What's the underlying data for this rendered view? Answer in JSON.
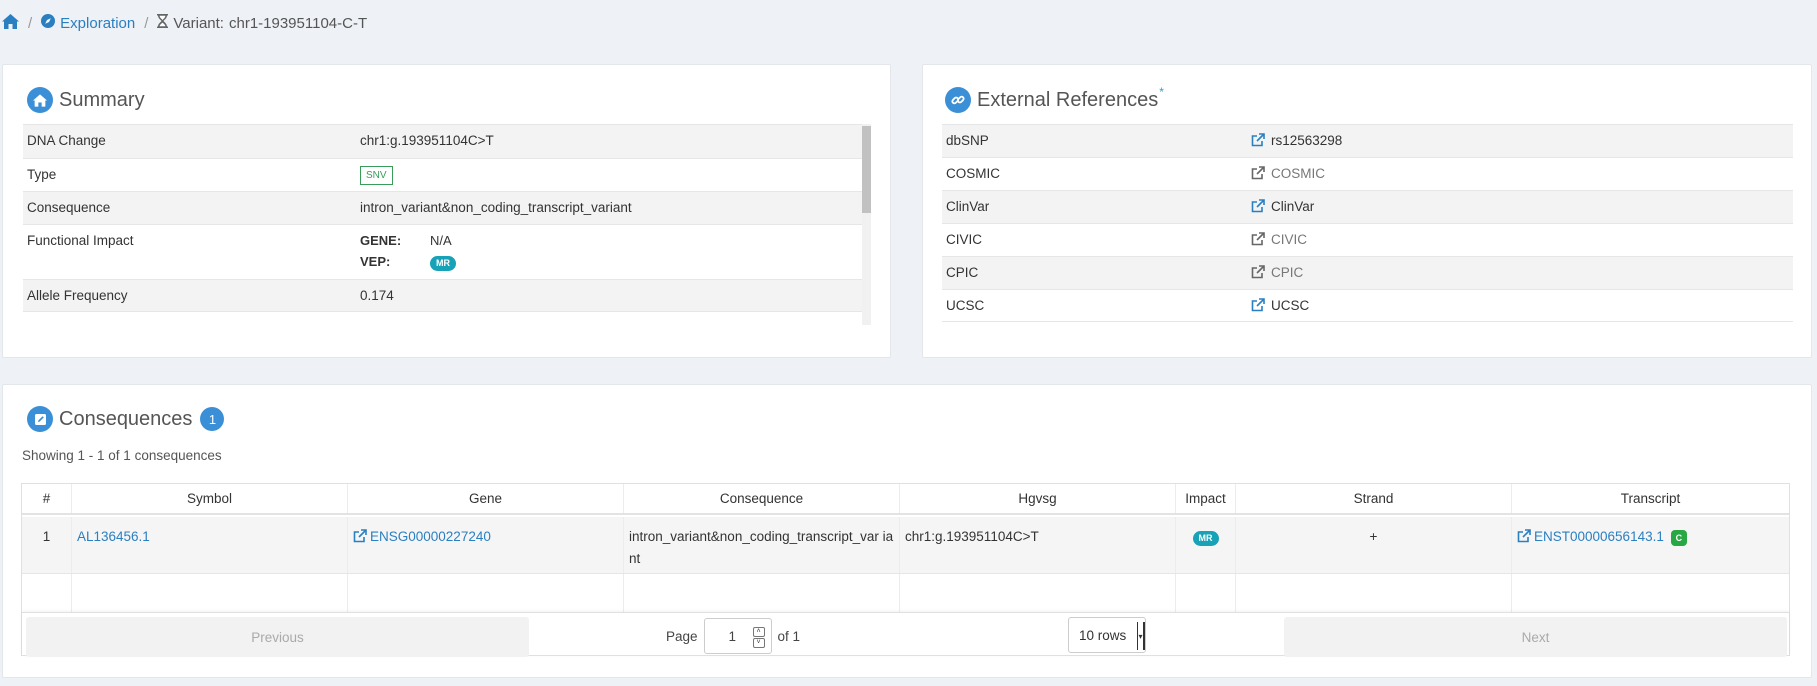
{
  "breadcrumb": {
    "exploration": "Exploration",
    "variant_prefix": "Variant:",
    "variant_id": "chr1-193951104-C-T"
  },
  "summary": {
    "title": "Summary",
    "rows": [
      {
        "key": "DNA Change",
        "value": "chr1:g.193951104C>T"
      },
      {
        "key": "Type",
        "value": "SNV"
      },
      {
        "key": "Consequence",
        "value": "intron_variant&non_coding_transcript_variant"
      },
      {
        "key": "Functional Impact",
        "gene_label": "GENE:",
        "gene_value": "N/A",
        "vep_label": "VEP:",
        "vep_value": "MR"
      },
      {
        "key": "Allele Frequency",
        "value": "0.174"
      }
    ]
  },
  "external": {
    "title": "External References",
    "asterisk": "*",
    "rows": [
      {
        "key": "dbSNP",
        "value": "rs12563298",
        "active": true
      },
      {
        "key": "COSMIC",
        "value": "COSMIC",
        "active": false
      },
      {
        "key": "ClinVar",
        "value": "ClinVar",
        "active": true
      },
      {
        "key": "CIVIC",
        "value": "CIVIC",
        "active": false
      },
      {
        "key": "CPIC",
        "value": "CPIC",
        "active": false
      },
      {
        "key": "UCSC",
        "value": "UCSC",
        "active": true
      }
    ]
  },
  "consequences": {
    "title": "Consequences",
    "count": "1",
    "showing": "Showing 1 - 1 of 1 consequences",
    "columns": [
      "#",
      "Symbol",
      "Gene",
      "Consequence",
      "Hgvsg",
      "Impact",
      "Strand",
      "Transcript"
    ],
    "rows": [
      {
        "num": "1",
        "symbol": "AL136456.1",
        "gene": "ENSG00000227240",
        "consequence": "intron_variant&non_coding_transcript_var iant",
        "hgvsg": "chr1:g.193951104C>T",
        "impact": "MR",
        "strand": "+",
        "transcript": "ENST00000656143.1",
        "transcript_badge": "C"
      }
    ],
    "pager": {
      "previous": "Previous",
      "next": "Next",
      "page_label": "Page",
      "page_value": "1",
      "of_label": "of 1",
      "rows_option": "10 rows"
    }
  },
  "colors": {
    "link": "#2a7fc1",
    "accent": "#3b8fd6",
    "mr_badge": "#17a2b8",
    "canonical_badge": "#28a745",
    "snv_border": "#3a9c5a"
  }
}
